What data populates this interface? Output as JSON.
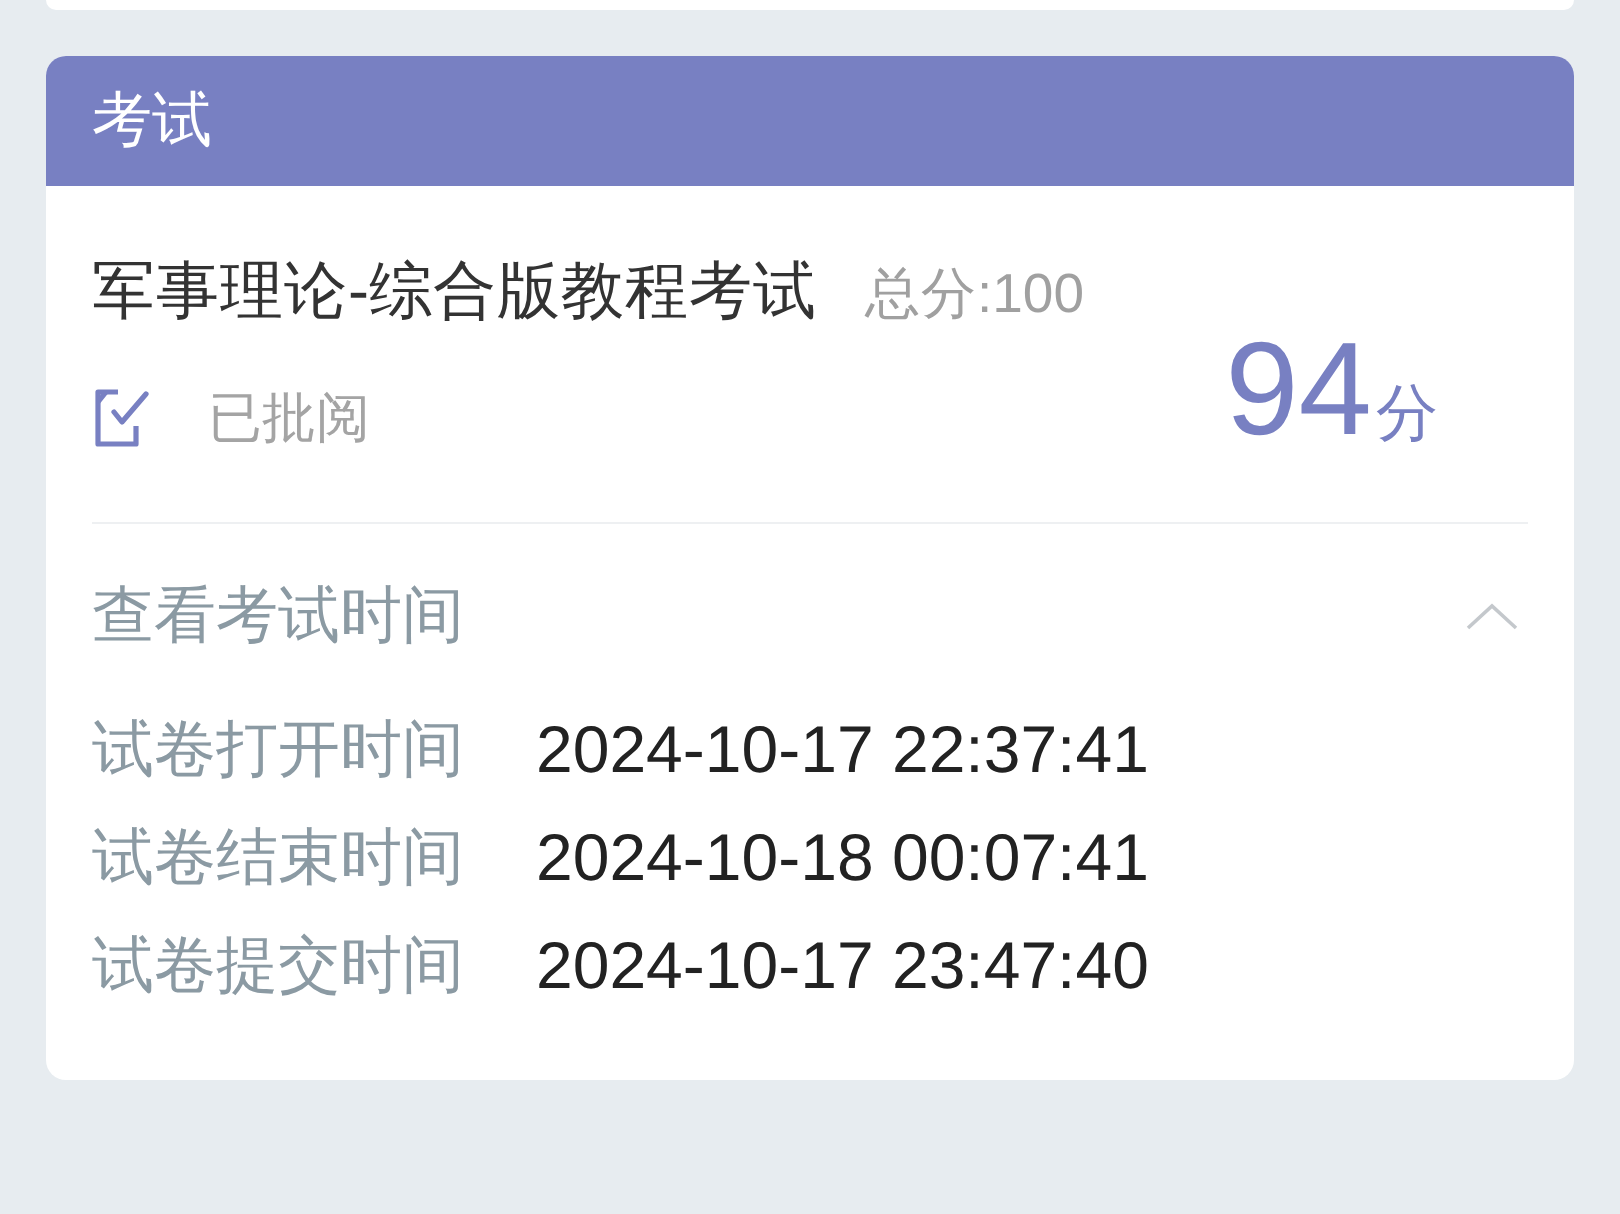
{
  "exam_section": {
    "header": "考试",
    "exam": {
      "title": "军事理论-综合版教程考试",
      "total_score": "总分:100",
      "status": "已批阅",
      "score": "94",
      "score_unit": "分"
    },
    "time_panel": {
      "label": "查看考试时间",
      "expanded": true,
      "rows": [
        {
          "label": "试卷打开时间",
          "value": "2024-10-17 22:37:41"
        },
        {
          "label": "试卷结束时间",
          "value": "2024-10-18 00:07:41"
        },
        {
          "label": "试卷提交时间",
          "value": "2024-10-17 23:47:40"
        }
      ]
    }
  }
}
